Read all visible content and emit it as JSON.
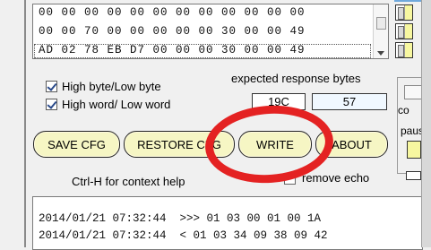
{
  "hex_view": {
    "rows": [
      "00 00 00 00 00 00 00 00 00 00 00 00",
      "00 00 70 00 00 00 00 00 30 00 00 49",
      "AD 02 78 EB D7 00 00 00 30 00 00 49"
    ]
  },
  "options": {
    "high_byte_low_byte": {
      "label": "High byte/Low byte",
      "checked": true
    },
    "high_word_low_word": {
      "label": "High word/ Low word",
      "checked": true
    },
    "remove_echo": {
      "label": "remove echo",
      "checked": false
    }
  },
  "expected_response": {
    "label": "expected response bytes",
    "field_1": "19C",
    "field_2": "57"
  },
  "buttons": {
    "save_cfg": "SAVE CFG",
    "restore_cfg": "RESTORE CFG",
    "write": "WRITE",
    "about": "ABOUT"
  },
  "help_text": "Ctrl-H for context help",
  "right_panel": {
    "label_co": "co",
    "label_pau": "paus"
  },
  "log": {
    "lines": [
      "2014/01/21 07:32:44  >>> 01 03 00 01 00 1A",
      "2014/01/21 07:32:44  < 01 03 34 09 38 09 42"
    ]
  },
  "colors": {
    "button_fill": "#f6f6c4",
    "annotation": "#e42222",
    "field_highlight": "#f0f8ff"
  }
}
